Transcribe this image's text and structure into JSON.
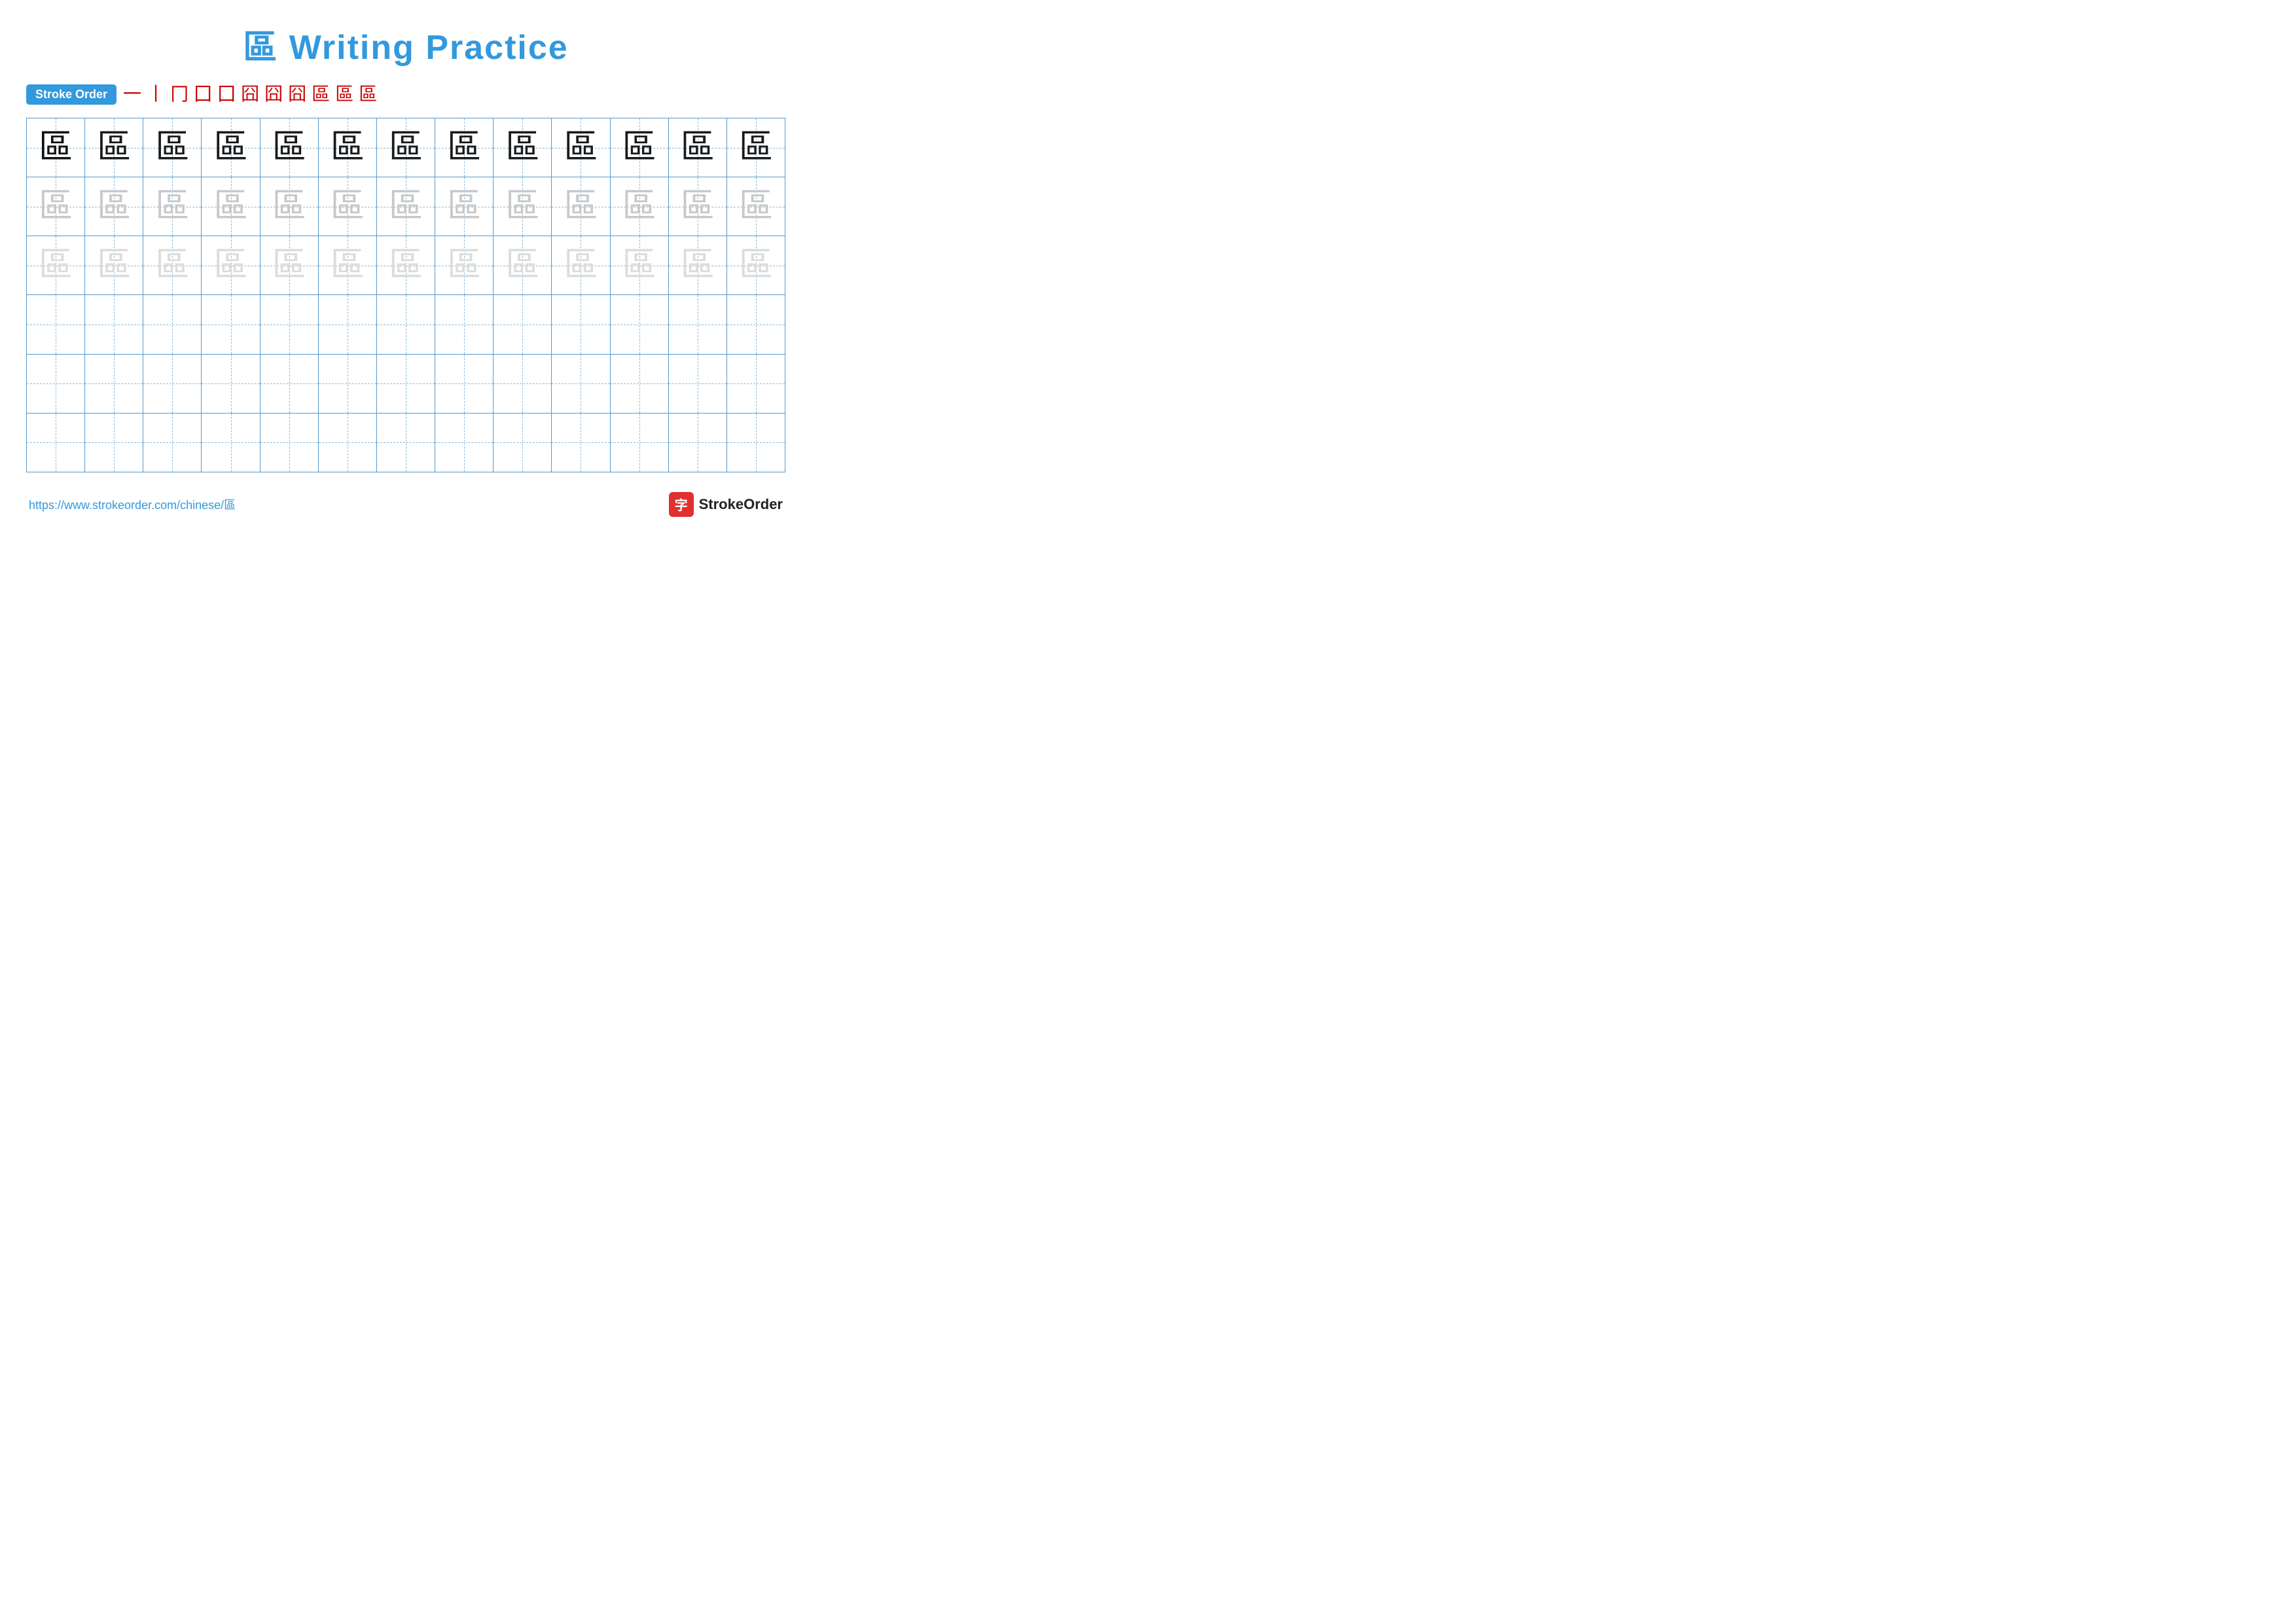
{
  "title": {
    "char": "區",
    "text": "Writing Practice"
  },
  "stroke_order": {
    "badge_label": "Stroke Order",
    "steps": [
      "一",
      "𠄌",
      "𠄎",
      "囗",
      "囗",
      "囧",
      "囧",
      "囧",
      "區",
      "區",
      "區"
    ]
  },
  "grid": {
    "rows": 6,
    "cols": 13,
    "char": "區",
    "row_styles": [
      "dark",
      "medium",
      "light",
      "empty",
      "empty",
      "empty"
    ]
  },
  "footer": {
    "link_text": "https://www.strokeorder.com/chinese/區",
    "brand_icon": "字",
    "brand_name": "StrokeOrder"
  }
}
